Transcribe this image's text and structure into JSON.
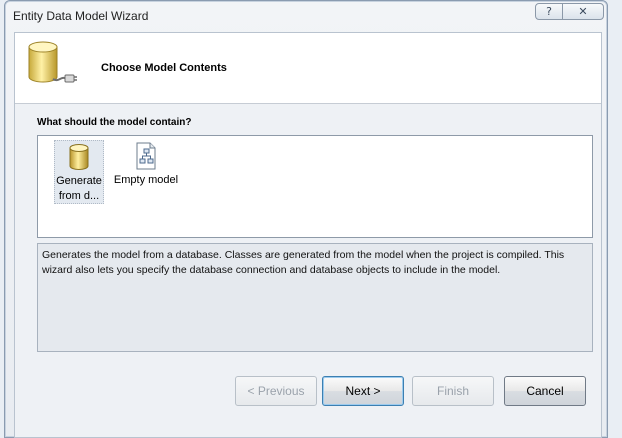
{
  "window": {
    "title": "Entity Data Model Wizard",
    "help_glyph": "?",
    "close_glyph": "✕"
  },
  "header": {
    "title": "Choose Model Contents",
    "icon": "database-plug-icon"
  },
  "question": "What should the model contain?",
  "choices": [
    {
      "label_line1": "Generate",
      "label_line2": "from d...",
      "icon": "database-icon",
      "selected": true
    },
    {
      "label_line1": "Empty model",
      "label_line2": "",
      "icon": "empty-model-icon",
      "selected": false
    }
  ],
  "description": "Generates the model from a database. Classes are generated from the model when the project is compiled. This wizard also lets you specify the database connection and database objects to include in the model.",
  "buttons": {
    "previous": "< Previous",
    "next": "Next >",
    "finish": "Finish",
    "cancel": "Cancel"
  }
}
